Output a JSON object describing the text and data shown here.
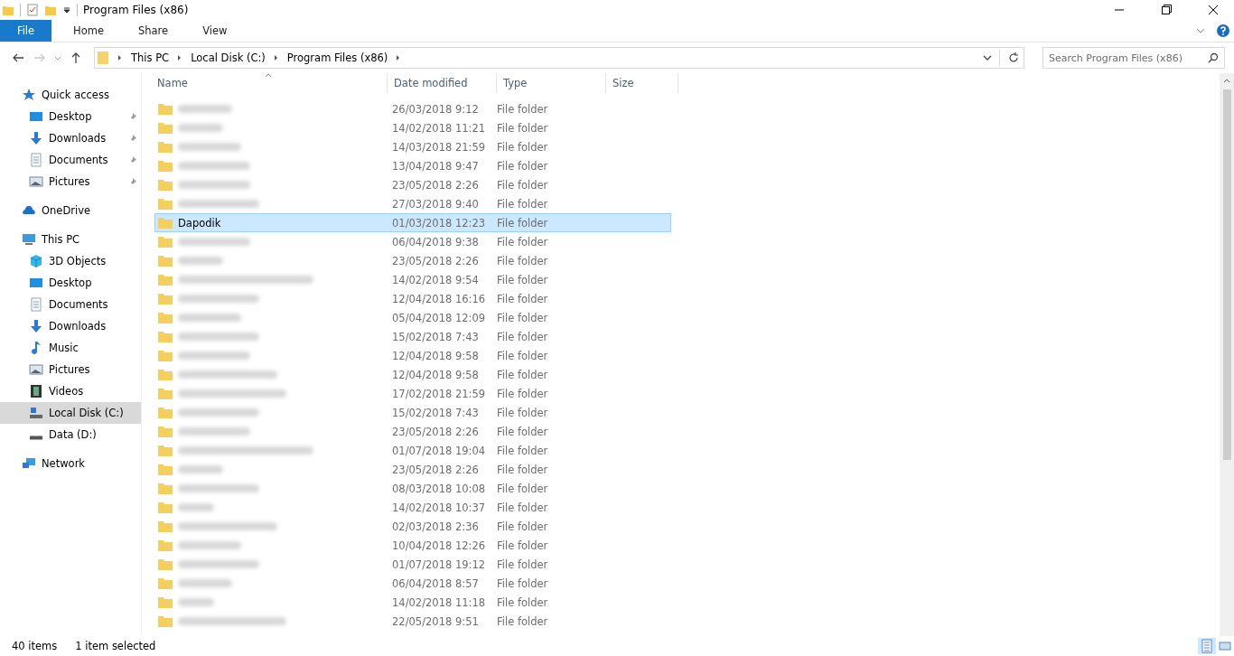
{
  "window": {
    "title": "Program Files (x86)"
  },
  "ribbon_tabs": [
    {
      "label": "File",
      "selected": true
    },
    {
      "label": "Home",
      "selected": false
    },
    {
      "label": "Share",
      "selected": false
    },
    {
      "label": "View",
      "selected": false
    }
  ],
  "address": {
    "crumbs": [
      "This PC",
      "Local Disk (C:)",
      "Program Files (x86)"
    ]
  },
  "search": {
    "placeholder": "Search Program Files (x86)"
  },
  "sidebar": [
    {
      "label": "Quick access",
      "selected": false,
      "children": [
        {
          "label": "Desktop",
          "pinned": true,
          "selected": false
        },
        {
          "label": "Downloads",
          "pinned": true,
          "selected": false
        },
        {
          "label": "Documents",
          "pinned": true,
          "selected": false
        },
        {
          "label": "Pictures",
          "pinned": true,
          "selected": false
        }
      ]
    },
    {
      "label": "OneDrive",
      "selected": false
    },
    {
      "label": "This PC",
      "selected": false,
      "children": [
        {
          "label": "3D Objects",
          "pinned": false,
          "selected": false
        },
        {
          "label": "Desktop",
          "pinned": false,
          "selected": false
        },
        {
          "label": "Documents",
          "pinned": false,
          "selected": false
        },
        {
          "label": "Downloads",
          "pinned": false,
          "selected": false
        },
        {
          "label": "Music",
          "pinned": false,
          "selected": false
        },
        {
          "label": "Pictures",
          "pinned": false,
          "selected": false
        },
        {
          "label": "Videos",
          "pinned": false,
          "selected": false
        },
        {
          "label": "Local Disk (C:)",
          "pinned": false,
          "selected": true
        },
        {
          "label": "Data (D:)",
          "pinned": false,
          "selected": false
        }
      ]
    },
    {
      "label": "Network",
      "selected": false
    }
  ],
  "table": {
    "columns": [
      "Name",
      "Date modified",
      "Type",
      "Size"
    ],
    "rows": [
      {
        "blurred": true,
        "date": "26/03/2018 9:12",
        "type": "File folder",
        "selected": false
      },
      {
        "blurred": true,
        "date": "14/02/2018 11:21",
        "type": "File folder",
        "selected": false
      },
      {
        "blurred": true,
        "date": "14/03/2018 21:59",
        "type": "File folder",
        "selected": false
      },
      {
        "blurred": true,
        "date": "13/04/2018 9:47",
        "type": "File folder",
        "selected": false
      },
      {
        "blurred": true,
        "date": "23/05/2018 2:26",
        "type": "File folder",
        "selected": false
      },
      {
        "blurred": true,
        "date": "27/03/2018 9:40",
        "type": "File folder",
        "selected": false
      },
      {
        "blurred": false,
        "name": "Dapodik",
        "date": "01/03/2018 12:23",
        "type": "File folder",
        "selected": true
      },
      {
        "blurred": true,
        "date": "06/04/2018 9:38",
        "type": "File folder",
        "selected": false
      },
      {
        "blurred": true,
        "date": "23/05/2018 2:26",
        "type": "File folder",
        "selected": false
      },
      {
        "blurred": true,
        "date": "14/02/2018 9:54",
        "type": "File folder",
        "selected": false
      },
      {
        "blurred": true,
        "date": "12/04/2018 16:16",
        "type": "File folder",
        "selected": false
      },
      {
        "blurred": true,
        "date": "05/04/2018 12:09",
        "type": "File folder",
        "selected": false
      },
      {
        "blurred": true,
        "date": "15/02/2018 7:43",
        "type": "File folder",
        "selected": false
      },
      {
        "blurred": true,
        "date": "12/04/2018 9:58",
        "type": "File folder",
        "selected": false
      },
      {
        "blurred": true,
        "date": "12/04/2018 9:58",
        "type": "File folder",
        "selected": false
      },
      {
        "blurred": true,
        "date": "17/02/2018 21:59",
        "type": "File folder",
        "selected": false
      },
      {
        "blurred": true,
        "date": "15/02/2018 7:43",
        "type": "File folder",
        "selected": false
      },
      {
        "blurred": true,
        "date": "23/05/2018 2:26",
        "type": "File folder",
        "selected": false
      },
      {
        "blurred": true,
        "date": "01/07/2018 19:04",
        "type": "File folder",
        "selected": false
      },
      {
        "blurred": true,
        "date": "23/05/2018 2:26",
        "type": "File folder",
        "selected": false
      },
      {
        "blurred": true,
        "date": "08/03/2018 10:08",
        "type": "File folder",
        "selected": false
      },
      {
        "blurred": true,
        "date": "14/02/2018 10:37",
        "type": "File folder",
        "selected": false
      },
      {
        "blurred": true,
        "date": "02/03/2018 2:36",
        "type": "File folder",
        "selected": false
      },
      {
        "blurred": true,
        "date": "10/04/2018 12:26",
        "type": "File folder",
        "selected": false
      },
      {
        "blurred": true,
        "date": "01/07/2018 19:12",
        "type": "File folder",
        "selected": false
      },
      {
        "blurred": true,
        "date": "06/04/2018 8:57",
        "type": "File folder",
        "selected": false
      },
      {
        "blurred": true,
        "date": "14/02/2018 11:18",
        "type": "File folder",
        "selected": false
      },
      {
        "blurred": true,
        "date": "22/05/2018 9:51",
        "type": "File folder",
        "selected": false
      }
    ]
  },
  "status_bar": {
    "count": "40 items",
    "selection": "1 item selected"
  }
}
